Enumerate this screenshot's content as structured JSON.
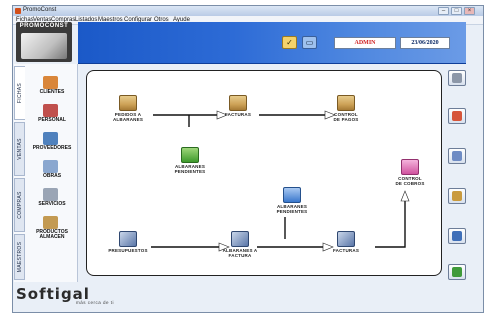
{
  "window": {
    "title": "PromoConst"
  },
  "menu": [
    "Fichas",
    "Ventas",
    "Compras",
    "Listados",
    "Maestros",
    "Configurar",
    "Otros",
    "Ayude"
  ],
  "logo": {
    "text": "PROMOCONST"
  },
  "header": {
    "user": "ADMIN",
    "date": "23/06/2020",
    "tools": [
      {
        "icon": "check-notepad-icon"
      },
      {
        "icon": "computer-icon"
      }
    ]
  },
  "sidebar": {
    "tabs": [
      "FICHAS",
      "VENTAS",
      "COMPRAS",
      "MAESTROS"
    ],
    "active_tab": "FICHAS",
    "items": [
      {
        "label": "CLIENTES",
        "icon": "clients-icon",
        "color": "#d9863a"
      },
      {
        "label": "PERSONAL",
        "icon": "staff-icon",
        "color": "#c0504d"
      },
      {
        "label": "PROVEEDORES",
        "icon": "suppliers-icon",
        "color": "#4f81bd"
      },
      {
        "label": "OBRAS",
        "icon": "works-icon",
        "color": "#8aa7cf"
      },
      {
        "label": "SERVICIOS",
        "icon": "services-icon",
        "color": "#9aa5b5"
      },
      {
        "label": "PRODUCTOS\nALMACEN",
        "icon": "products-icon",
        "color": "#c39a52"
      }
    ]
  },
  "flow": {
    "nodes": [
      {
        "id": "pedidos",
        "label": "PEDIDOS A\nALBARANES"
      },
      {
        "id": "facturas_compra",
        "label": "FACTURAS"
      },
      {
        "id": "control_pagos",
        "label": "CONTROL\nDE PAGOS"
      },
      {
        "id": "albaranes_pend_compra",
        "label": "ALBARANES\nPENDIENTES"
      },
      {
        "id": "control_cobros",
        "label": "CONTROL\nDE COBROS"
      },
      {
        "id": "albaranes_pend_venta",
        "label": "ALBARANES\nPENDIENTES"
      },
      {
        "id": "presupuestos",
        "label": "PRESUPUESTOS"
      },
      {
        "id": "albaranes_venta",
        "label": "ALBARANES A\nFACTURA"
      },
      {
        "id": "facturas_venta",
        "label": "FACTURAS"
      }
    ]
  },
  "rightbar": [
    {
      "icon": "key-icon"
    },
    {
      "icon": "calendar-icon"
    },
    {
      "icon": "document-icon"
    },
    {
      "icon": "folder-icon"
    },
    {
      "icon": "disk-icon"
    },
    {
      "icon": "puzzle-icon"
    }
  ],
  "footer": {
    "brand": "Softigal",
    "tagline": "más cerca de ti"
  }
}
